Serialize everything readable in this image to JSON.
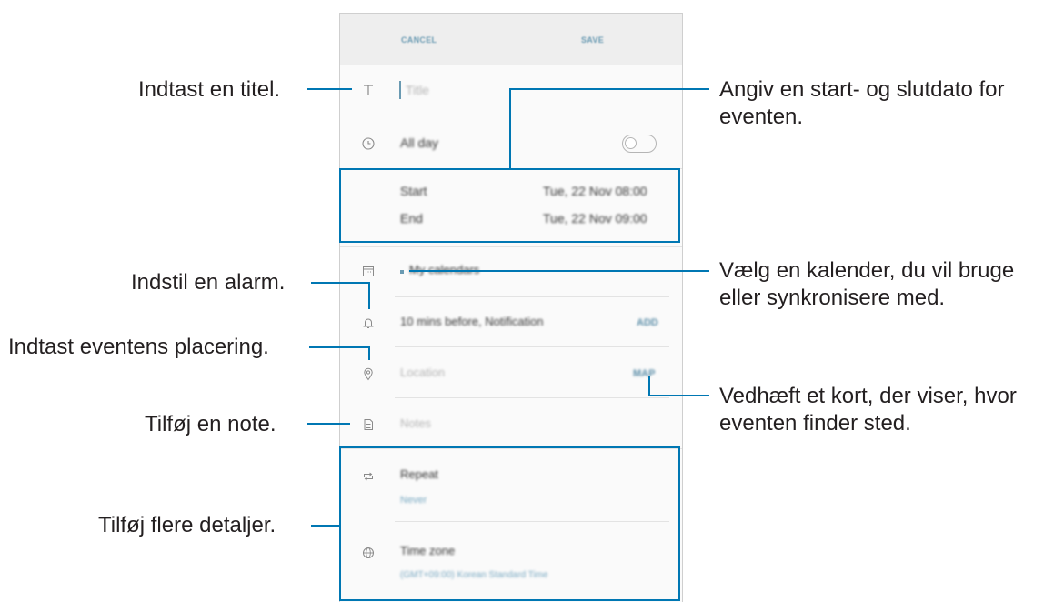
{
  "app_bar": {
    "cancel": "CANCEL",
    "save": "SAVE"
  },
  "form": {
    "title_placeholder": "Title",
    "all_day": "All day",
    "start_label": "Start",
    "start_value": "Tue, 22 Nov   08:00",
    "end_label": "End",
    "end_value": "Tue, 22 Nov   09:00",
    "calendar": "My calendars",
    "reminder": "10 mins before, Notification",
    "reminder_action": "ADD",
    "location_placeholder": "Location",
    "map_action": "MAP",
    "notes_placeholder": "Notes",
    "repeat_label": "Repeat",
    "repeat_value": "Never",
    "timezone_label": "Time zone",
    "timezone_value": "(GMT+09:00) Korean Standard Time"
  },
  "annotations": {
    "title": "Indtast en titel.",
    "dates_line1": "Angiv en start- og slutdato for",
    "dates_line2": "eventen.",
    "calendar_line1": "Vælg en kalender, du vil bruge",
    "calendar_line2": "eller synkronisere med.",
    "alarm": "Indstil en alarm.",
    "location": "Indtast eventens placering.",
    "map_line1": "Vedhæft et kort, der viser, hvor",
    "map_line2": "eventen finder sted.",
    "note": "Tilføj en note.",
    "details": "Tilføj flere detaljer."
  },
  "icons": [
    "text-icon",
    "clock-icon",
    "calendar-icon",
    "bell-icon",
    "location-pin-icon",
    "note-icon",
    "repeat-icon",
    "globe-icon"
  ],
  "colors": {
    "callout": "#0077b3",
    "accent": "#6a9ab2"
  }
}
